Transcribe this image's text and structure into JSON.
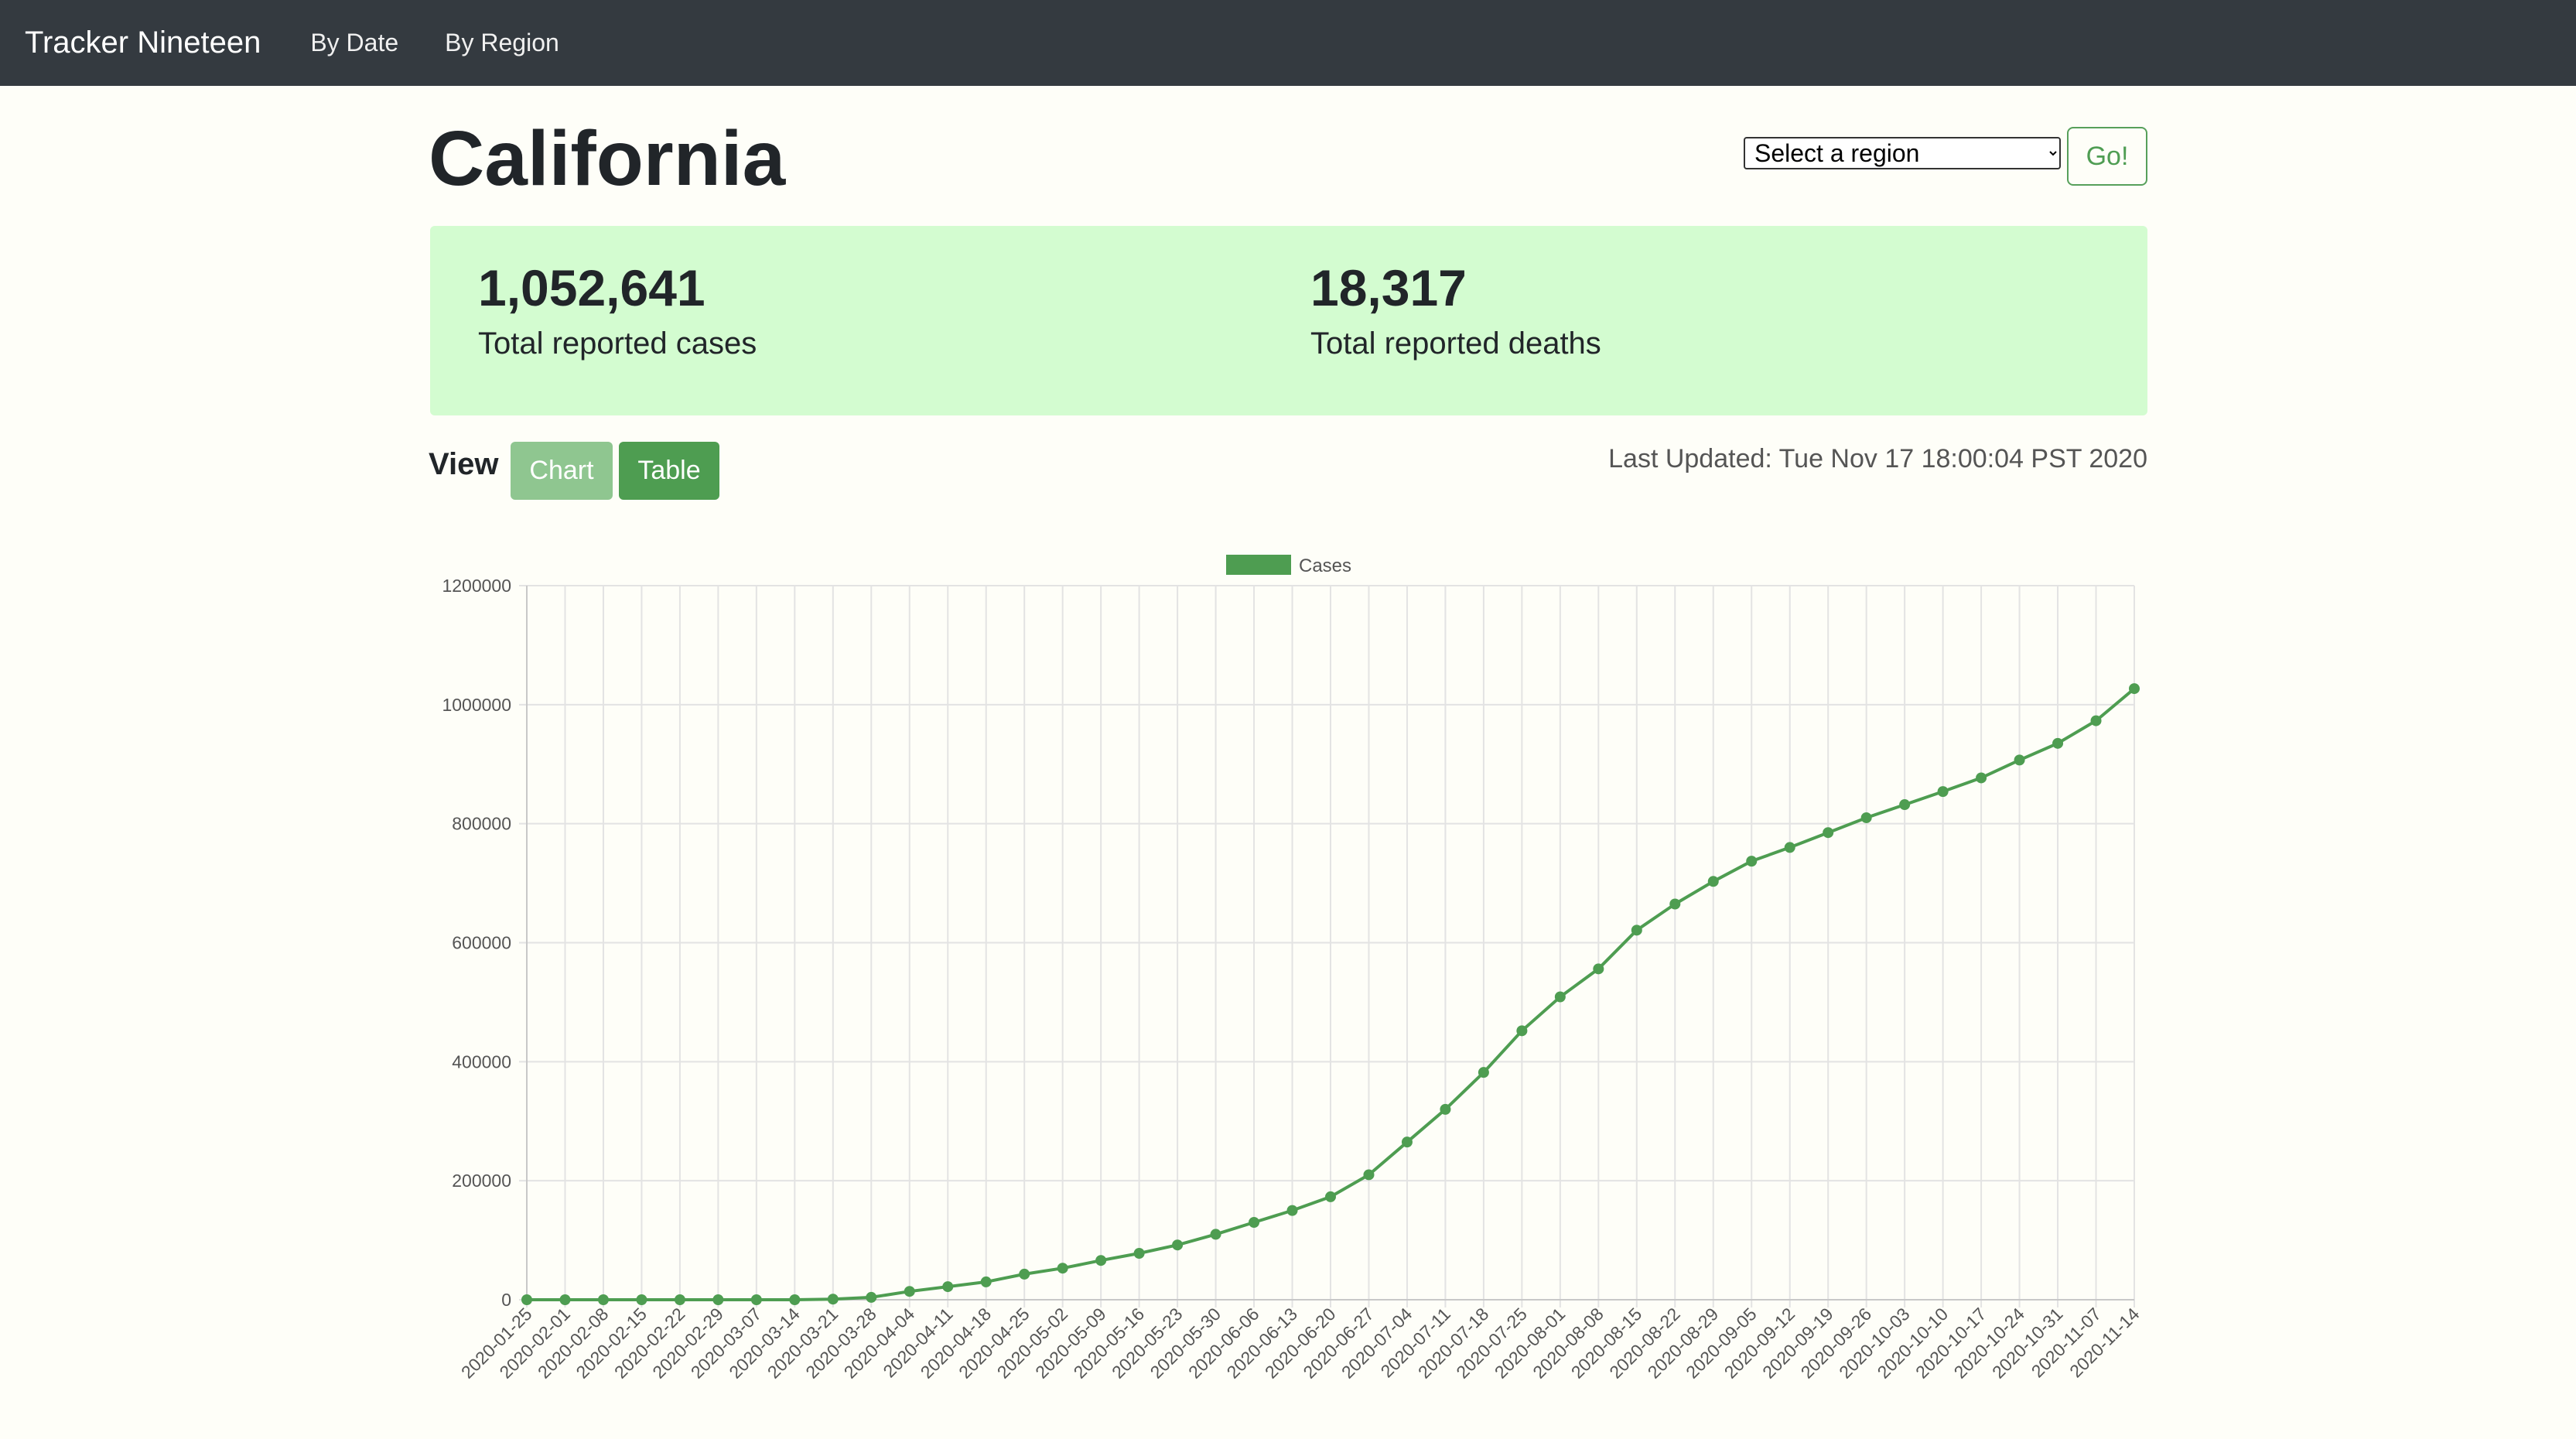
{
  "nav": {
    "brand": "Tracker Nineteen",
    "links": [
      "By Date",
      "By Region"
    ]
  },
  "page": {
    "title": "California"
  },
  "region_select": {
    "selected": "Select a region"
  },
  "go_button": {
    "label": "Go!"
  },
  "stats": {
    "cases": {
      "value": "1,052,641",
      "label": "Total reported cases"
    },
    "deaths": {
      "value": "18,317",
      "label": "Total reported deaths"
    }
  },
  "view": {
    "label": "View",
    "chart_label": "Chart",
    "table_label": "Table",
    "last_updated": "Last Updated: Tue Nov 17 18:00:04 PST 2020"
  },
  "colors": {
    "navbar": "#343a40",
    "accent": "#4e9d51",
    "stats_bg": "#d3fcd0"
  },
  "chart_data": {
    "type": "line",
    "legend": [
      "Cases"
    ],
    "legend_position": "top",
    "grid": true,
    "ylim": [
      0,
      1200000
    ],
    "yticks": [
      0,
      200000,
      400000,
      600000,
      800000,
      1000000,
      1200000
    ],
    "categories": [
      "2020-01-25",
      "2020-02-01",
      "2020-02-08",
      "2020-02-15",
      "2020-02-22",
      "2020-02-29",
      "2020-03-07",
      "2020-03-14",
      "2020-03-21",
      "2020-03-28",
      "2020-04-04",
      "2020-04-11",
      "2020-04-18",
      "2020-04-25",
      "2020-05-02",
      "2020-05-09",
      "2020-05-16",
      "2020-05-23",
      "2020-05-30",
      "2020-06-06",
      "2020-06-13",
      "2020-06-20",
      "2020-06-27",
      "2020-07-04",
      "2020-07-11",
      "2020-07-18",
      "2020-07-25",
      "2020-08-01",
      "2020-08-08",
      "2020-08-15",
      "2020-08-22",
      "2020-08-29",
      "2020-09-05",
      "2020-09-12",
      "2020-09-19",
      "2020-09-26",
      "2020-10-03",
      "2020-10-10",
      "2020-10-17",
      "2020-10-24",
      "2020-10-31",
      "2020-11-07",
      "2020-11-14"
    ],
    "series": [
      {
        "name": "Cases",
        "color": "#4e9d51",
        "values": [
          0,
          0,
          0,
          0,
          0,
          0,
          0,
          0,
          1000,
          4000,
          14000,
          22000,
          30000,
          43000,
          53000,
          66000,
          78000,
          92000,
          110000,
          130000,
          150000,
          173000,
          210000,
          265000,
          320000,
          382000,
          452000,
          509000,
          556000,
          621000,
          665000,
          703000,
          737000,
          760000,
          785000,
          810000,
          832000,
          854000,
          877000,
          907000,
          935000,
          973000,
          1027000
        ]
      }
    ]
  }
}
